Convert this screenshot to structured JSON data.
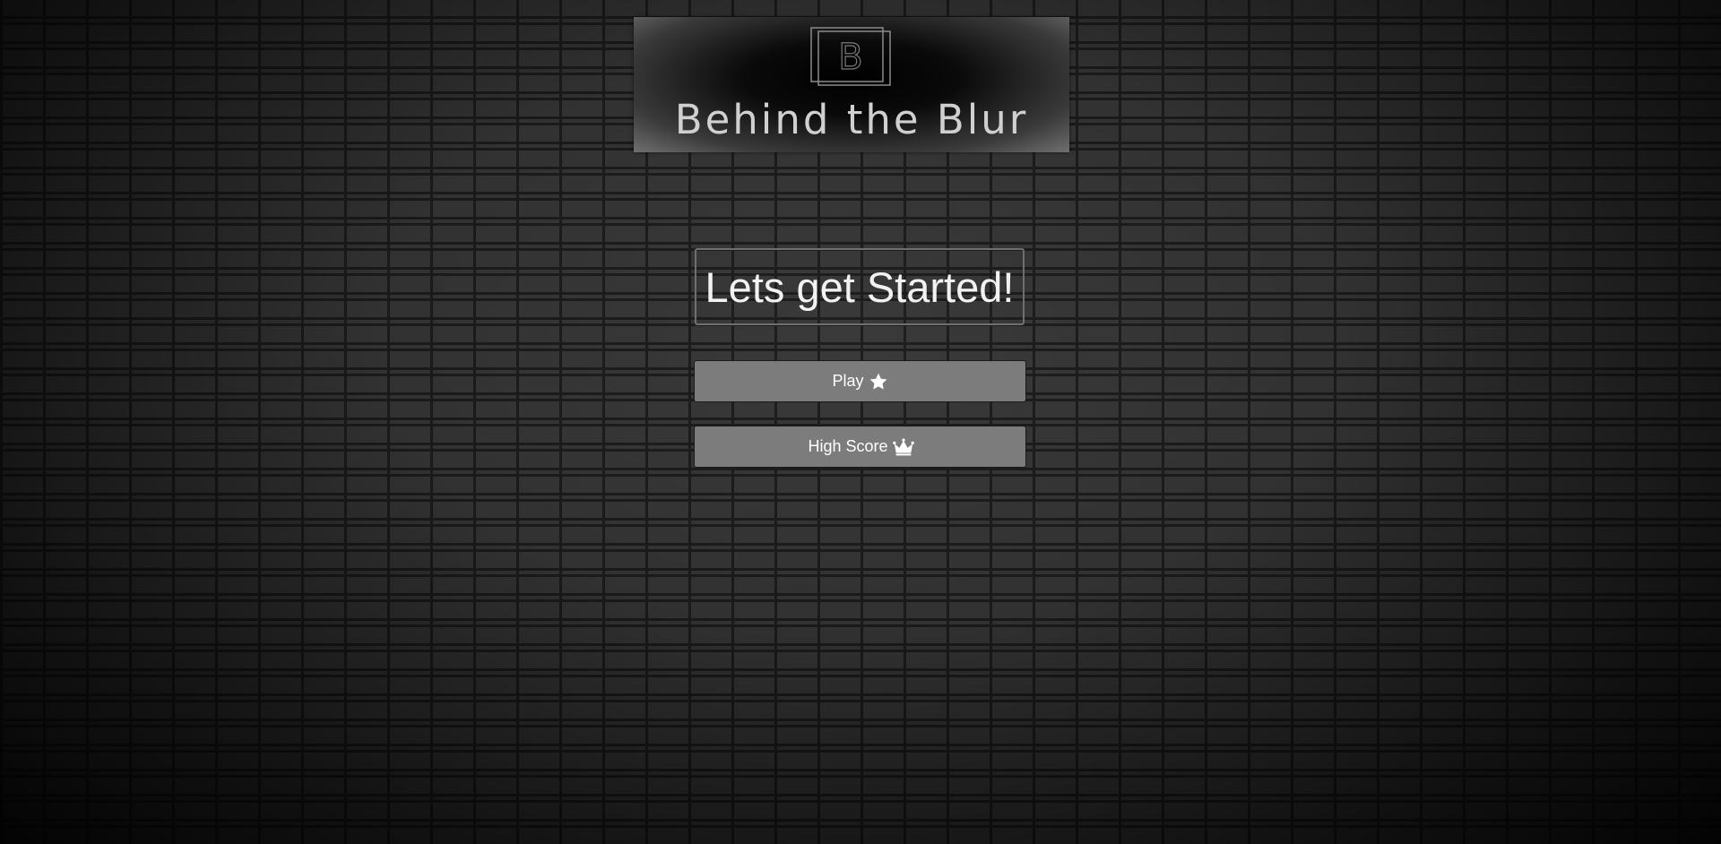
{
  "app": {
    "logo_text": "Behind the Blur",
    "logo_mark_letter": "B"
  },
  "main": {
    "heading": "Lets get Started!",
    "buttons": [
      {
        "label": "Play",
        "icon": "star-icon"
      },
      {
        "label": "High Score",
        "icon": "crown-icon"
      }
    ]
  },
  "colors": {
    "button_bg": "#7c7c7c",
    "button_text": "#ffffff",
    "heading_border": "#6f6f6f",
    "wall": "#3a3a3a"
  }
}
